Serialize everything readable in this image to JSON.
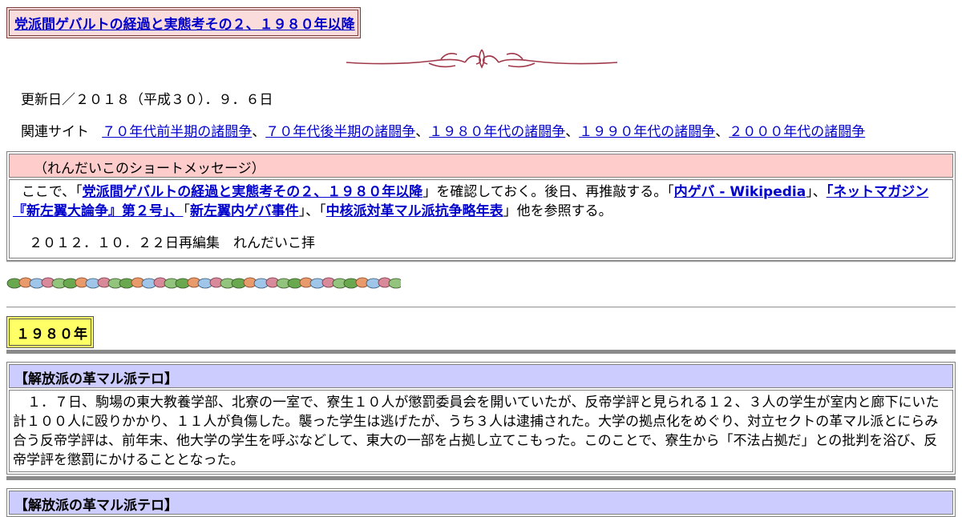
{
  "title": "党派間ゲバルトの経過と実態考その２、１９８０年以降",
  "updated": "更新日／２０１８（平成３０）．９．６日",
  "related": {
    "label": "関連サイト",
    "links": [
      "７０年代前半期の諸闘争",
      "７０年代後半期の諸闘争",
      "１９８０年代の諸闘争",
      "１９９０年代の諸闘争",
      "２０００年代の諸闘争"
    ],
    "separator": "、"
  },
  "message": {
    "heading": "（れんだいこのショートメッセージ）",
    "intro": "ここで、「",
    "link_title": "党派間ゲバルトの経過と実態考その２、１９８０年以降",
    "mid1": "」を確認しておく。後日、再推敲する。「",
    "link_wiki": "内ゲバ - Wikipedia",
    "mid2": "」、",
    "link_magazine": "「ネットマガジン『新左翼大論争』第２号」、",
    "mid3": "「",
    "link_incidents": "新左翼内ゲバ事件",
    "mid4": "」、「",
    "link_table": "中核派対革マル派抗争略年表",
    "tail": "」他を参照する。",
    "signature": "２０１２．１０．２２日再編集　れんだいこ拝"
  },
  "year_heading": "１９８０年",
  "sections": [
    {
      "heading": "【解放派の革マル派テロ】",
      "body": "１．７日、駒場の東大教養学部、北寮の一室で、寮生１０人が懲罰委員会を開いていたが、反帝学評と見られる１２、３人の学生が室内と廊下にいた計１００人に殴りかかり、１１人が負傷した。襲った学生は逃げたが、うち３人は逮捕された。大学の拠点化をめぐり、対立セクトの革マル派とにらみ合う反帝学評は、前年末、他大学の学生を呼ぶなどして、東大の一部を占拠し立てこもった。このことで、寮生から「不法占拠だ」との批判を浴び、反帝学評を懲罰にかけることとなった。"
    },
    {
      "heading": "【解放派の革マル派テロ】"
    }
  ],
  "colors": {
    "title_bg": "#fbdcdc",
    "message_head_bg": "#ffcccc",
    "year_bg": "#ffff66",
    "section_head_bg": "#ccccff",
    "link": "#0000cc"
  }
}
